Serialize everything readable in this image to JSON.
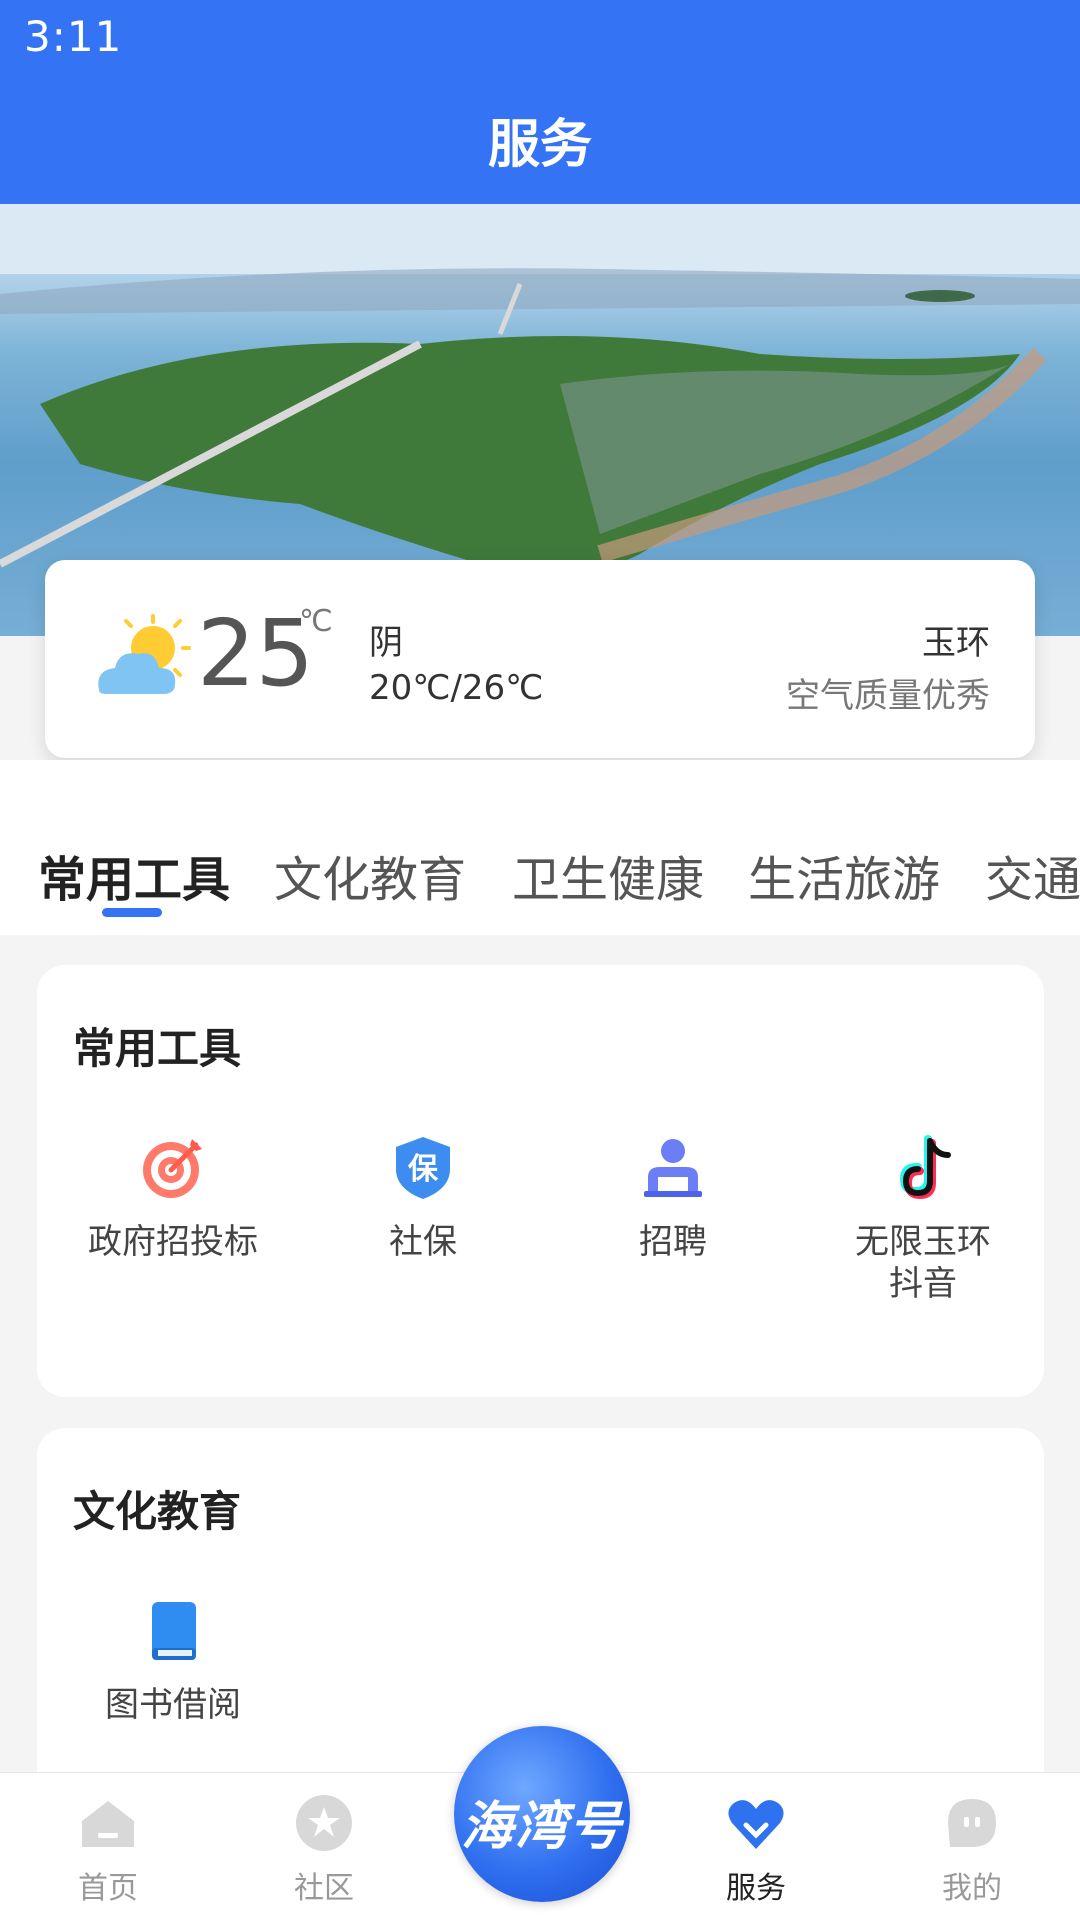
{
  "status_bar": {
    "time": "3:11"
  },
  "header": {
    "title": "服务"
  },
  "weather": {
    "temperature": "25",
    "unit": "℃",
    "condition": "阴",
    "range": "20℃/26℃",
    "city": "玉环",
    "air_quality": "空气质量优秀"
  },
  "tabs": [
    {
      "label": "常用工具"
    },
    {
      "label": "文化教育"
    },
    {
      "label": "卫生健康"
    },
    {
      "label": "生活旅游"
    },
    {
      "label": "交通"
    }
  ],
  "sections": [
    {
      "title": "常用工具",
      "tools": [
        {
          "label": "政府招投标",
          "icon": "target-icon"
        },
        {
          "label": "社保",
          "icon": "shield-icon"
        },
        {
          "label": "招聘",
          "icon": "recruit-person-icon"
        },
        {
          "label": "无限玉环\n抖音",
          "icon": "tiktok-icon"
        }
      ]
    },
    {
      "title": "文化教育",
      "tools": [
        {
          "label": "图书借阅",
          "icon": "book-icon"
        }
      ]
    }
  ],
  "bottom_nav": [
    {
      "label": "首页",
      "icon": "home-icon"
    },
    {
      "label": "社区",
      "icon": "star-icon"
    },
    {
      "label": "服务",
      "icon": "heart-icon"
    },
    {
      "label": "我的",
      "icon": "profile-icon"
    }
  ],
  "center_logo": {
    "text": "海湾号"
  },
  "colors": {
    "primary": "#3573f5",
    "background": "#f4f4f4"
  }
}
